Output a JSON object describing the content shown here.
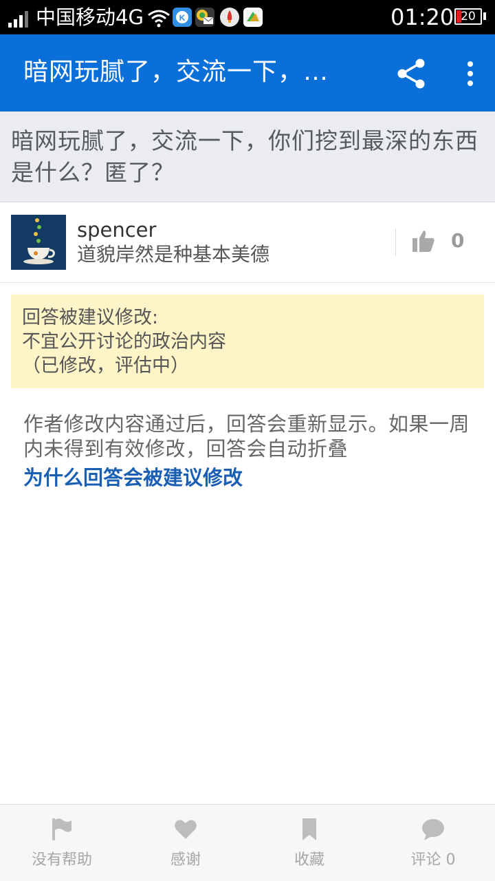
{
  "status_bar": {
    "carrier": "中国移动4G",
    "time": "01:20",
    "battery": "20"
  },
  "app_bar": {
    "title": "暗网玩腻了，交流一下，你们挖到最深的东西是什么？匿了？",
    "share_icon": "share-icon",
    "more_icon": "more-vert-icon"
  },
  "question": {
    "text": "暗网玩腻了，交流一下，你们挖到最深的东西是什么？匿了？"
  },
  "author": {
    "name": "spencer",
    "bio": "道貌岸然是种基本美德",
    "votes": "0"
  },
  "notice": {
    "line1": "回答被建议修改:",
    "line2": "不宜公开讨论的政治内容",
    "line3": "（已修改，评估中）"
  },
  "explanation": "作者修改内容通过后，回答会重新显示。如果一周内未得到有效修改，回答会自动折叠",
  "why_link": "为什么回答会被建议修改",
  "bottom_bar": {
    "items": [
      {
        "label": "没有帮助",
        "icon": "flag-icon"
      },
      {
        "label": "感谢",
        "icon": "heart-icon"
      },
      {
        "label": "收藏",
        "icon": "bookmark-icon"
      },
      {
        "label": "评论 0",
        "icon": "comment-icon"
      }
    ]
  },
  "colors": {
    "app_bar": "#0a6fd8",
    "question_bg": "#eaecf0",
    "notice_bg": "#fdf4c8",
    "link": "#1a5fb4"
  }
}
